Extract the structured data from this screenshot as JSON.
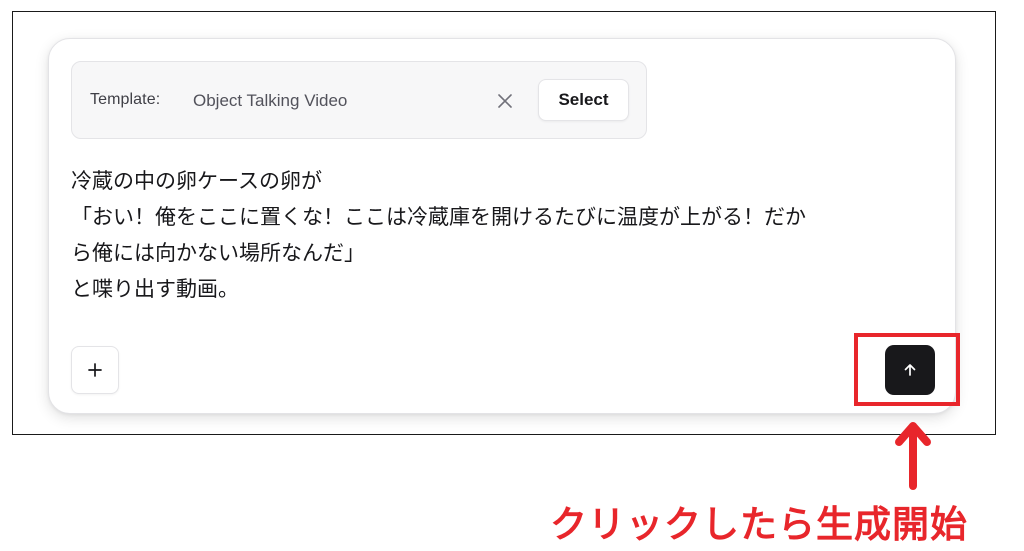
{
  "template_bar": {
    "label": "Template:",
    "value": "Object Talking Video",
    "clear_icon": "x-icon",
    "select_label": "Select"
  },
  "prompt": {
    "lines": [
      "冷蔵の中の卵ケースの卵が",
      "「おい！俺をここに置くな！ここは冷蔵庫を開けるたびに温度が上がる！だか",
      "ら俺には向かない場所なんだ」",
      "と喋り出す動画。"
    ]
  },
  "footer": {
    "add_icon": "plus-icon",
    "send_icon": "arrow-up-icon"
  },
  "annotation": {
    "text": "クリックしたら生成開始",
    "color": "#e8262b",
    "arrow_icon": "arrow-up-icon"
  },
  "colors": {
    "accent": "#e8262b",
    "send_button": "#18181b"
  }
}
